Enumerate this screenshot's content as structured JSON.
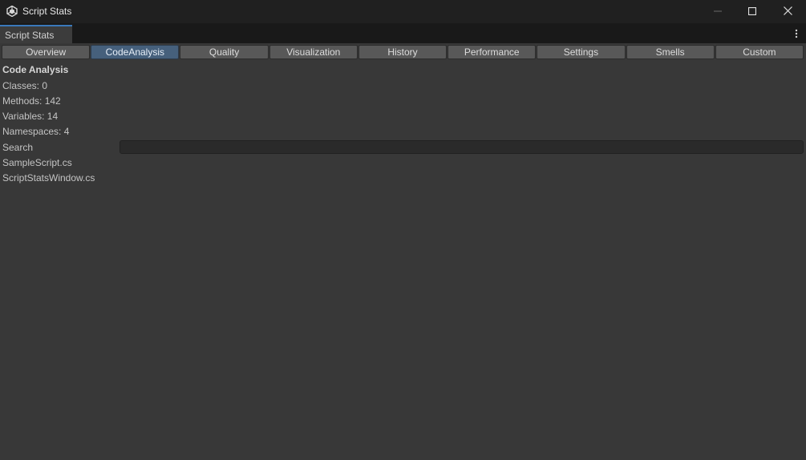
{
  "window": {
    "title": "Script Stats",
    "app_icon": "unity-icon",
    "controls": [
      "minimize-icon",
      "maximize-icon",
      "close-icon"
    ]
  },
  "dock": {
    "tab_label": "Script Stats",
    "menu_icon": "kebab-menu-icon"
  },
  "toolbar": {
    "tabs": [
      {
        "label": "Overview",
        "active": false
      },
      {
        "label": "CodeAnalysis",
        "active": true
      },
      {
        "label": "Quality",
        "active": false
      },
      {
        "label": "Visualization",
        "active": false
      },
      {
        "label": "History",
        "active": false
      },
      {
        "label": "Performance",
        "active": false
      },
      {
        "label": "Settings",
        "active": false
      },
      {
        "label": "Smells",
        "active": false
      },
      {
        "label": "Custom",
        "active": false
      }
    ]
  },
  "content": {
    "heading": "Code Analysis",
    "stats": [
      "Classes: 0",
      "Methods: 142",
      "Variables: 14",
      "Namespaces: 4"
    ],
    "search": {
      "label": "Search",
      "value": "",
      "placeholder": ""
    },
    "files": [
      "SampleScript.cs",
      "ScriptStatsWindow.cs"
    ]
  },
  "colors": {
    "background": "#383838",
    "titlebar": "#202020",
    "active_tab": "#46607c",
    "tab": "#585858",
    "dock_accent": "#3a79bb"
  }
}
